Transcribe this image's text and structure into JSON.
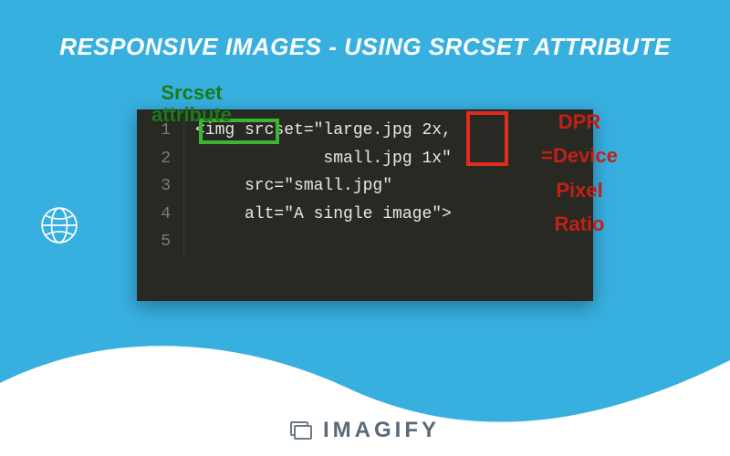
{
  "title": "RESPONSIVE IMAGES - USING SRCSET ATTRIBUTE",
  "labels": {
    "green": "Srcset attribute",
    "red_line1": "DPR",
    "red_line2": "=Device",
    "red_line3": "Pixel",
    "red_line4": "Ratio"
  },
  "code": {
    "lines": [
      {
        "gutter": "1",
        "content": "<img srcset=\"large.jpg 2x,"
      },
      {
        "gutter": "2",
        "content": "             small.jpg 1x\""
      },
      {
        "gutter": "3",
        "content": "     src=\"small.jpg\""
      },
      {
        "gutter": "4",
        "content": "     alt=\"A single image\">"
      },
      {
        "gutter": "5",
        "content": ""
      }
    ]
  },
  "brand": "IMAGIFY",
  "colors": {
    "bg": "#37b0e0",
    "code_bg": "#282923",
    "green": "#3ab536",
    "red": "#e12c1d"
  }
}
